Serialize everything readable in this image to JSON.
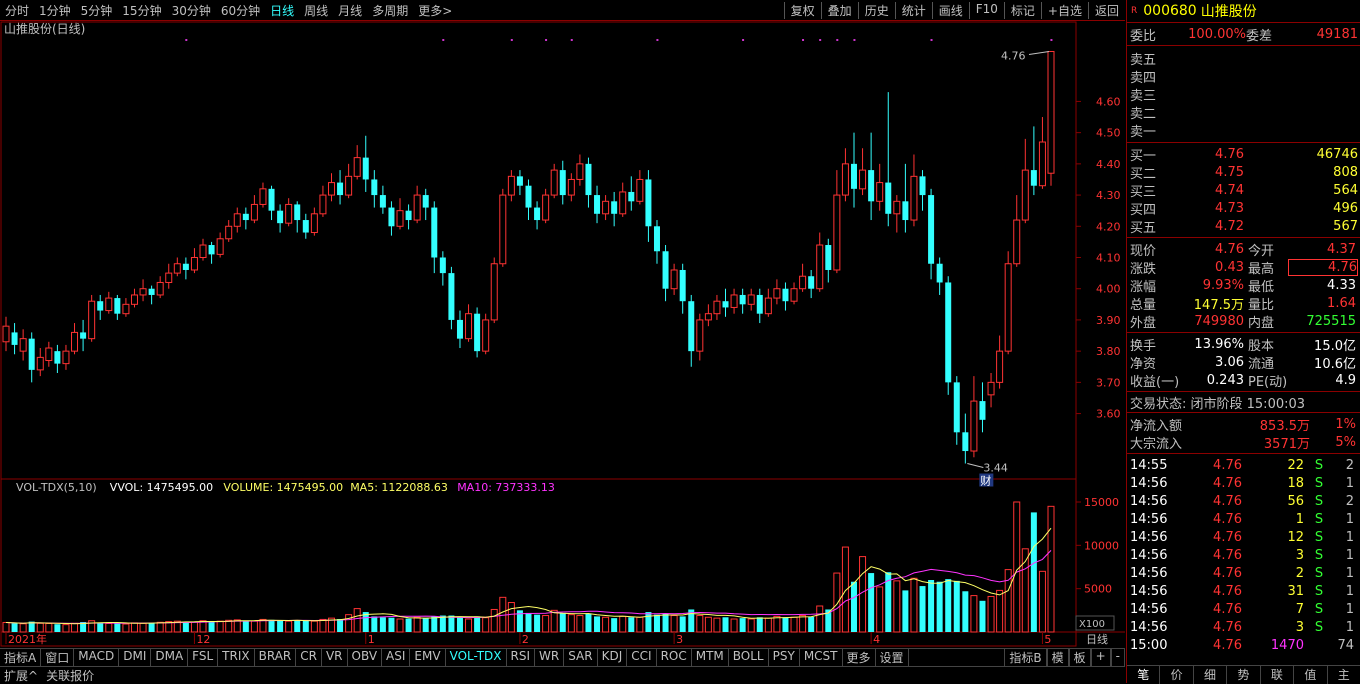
{
  "toolbar": {
    "periods": [
      {
        "label": "分时"
      },
      {
        "label": "1分钟"
      },
      {
        "label": "5分钟"
      },
      {
        "label": "15分钟"
      },
      {
        "label": "30分钟"
      },
      {
        "label": "60分钟"
      },
      {
        "label": "日线",
        "active": true
      },
      {
        "label": "周线"
      },
      {
        "label": "月线"
      },
      {
        "label": "多周期"
      },
      {
        "label": "更多>"
      }
    ],
    "tools": [
      "复权",
      "叠加",
      "历史",
      "统计",
      "画线",
      "F10",
      "标记",
      "+自选",
      "返回"
    ]
  },
  "chart": {
    "title": "山推股份(日线)",
    "price_labels": [
      "4.60",
      "4.50",
      "4.40",
      "4.30",
      "4.20",
      "4.10",
      "4.00",
      "3.90",
      "3.80",
      "3.70",
      "3.60"
    ],
    "max_marker": "4.76",
    "min_marker": "3.44",
    "fin_badge": "财",
    "vol_header": {
      "name": "VOL-TDX(5,10)",
      "vvol": "VVOL: 1475495.00",
      "volume": "VOLUME: 1475495.00",
      "ma5": "MA5: 1122088.63",
      "ma10": "MA10: 737333.13"
    },
    "vol_labels": [
      "15000",
      "10000",
      "5000"
    ],
    "vol_unit": "X100",
    "date_labels": [
      {
        "text": "2021年",
        "i": 0
      },
      {
        "text": "12",
        "i": 22
      },
      {
        "text": "1",
        "i": 42
      },
      {
        "text": "2",
        "i": 60
      },
      {
        "text": "3",
        "i": 78
      },
      {
        "text": "4",
        "i": 101
      },
      {
        "text": "5",
        "i": 121
      }
    ],
    "period_label": "日线"
  },
  "chart_data": {
    "type": "candlestick",
    "ylim": [
      3.4,
      4.8
    ],
    "vol_ylim": [
      0,
      16500
    ],
    "candles": [
      [
        3.83,
        3.88,
        3.8,
        3.91
      ],
      [
        3.86,
        3.82,
        3.79,
        3.89
      ],
      [
        3.8,
        3.84,
        3.77,
        3.87
      ],
      [
        3.84,
        3.74,
        3.7,
        3.86
      ],
      [
        3.74,
        3.78,
        3.72,
        3.81
      ],
      [
        3.77,
        3.81,
        3.75,
        3.83
      ],
      [
        3.8,
        3.76,
        3.73,
        3.82
      ],
      [
        3.76,
        3.8,
        3.74,
        3.82
      ],
      [
        3.8,
        3.86,
        3.79,
        3.89
      ],
      [
        3.86,
        3.84,
        3.8,
        3.9
      ],
      [
        3.84,
        3.96,
        3.83,
        3.98
      ],
      [
        3.96,
        3.93,
        3.9,
        3.98
      ],
      [
        3.93,
        3.97,
        3.92,
        3.99
      ],
      [
        3.97,
        3.92,
        3.9,
        3.98
      ],
      [
        3.92,
        3.95,
        3.91,
        3.97
      ],
      [
        3.95,
        3.98,
        3.94,
        4.0
      ],
      [
        3.98,
        4.0,
        3.96,
        4.03
      ],
      [
        4.0,
        3.98,
        3.95,
        4.01
      ],
      [
        3.98,
        4.02,
        3.97,
        4.04
      ],
      [
        4.02,
        4.05,
        4.0,
        4.08
      ],
      [
        4.05,
        4.08,
        4.04,
        4.1
      ],
      [
        4.08,
        4.06,
        4.03,
        4.1
      ],
      [
        4.06,
        4.1,
        4.05,
        4.13
      ],
      [
        4.1,
        4.14,
        4.09,
        4.16
      ],
      [
        4.14,
        4.11,
        4.08,
        4.15
      ],
      [
        4.11,
        4.16,
        4.1,
        4.18
      ],
      [
        4.16,
        4.2,
        4.15,
        4.22
      ],
      [
        4.2,
        4.24,
        4.18,
        4.26
      ],
      [
        4.24,
        4.22,
        4.19,
        4.26
      ],
      [
        4.22,
        4.27,
        4.21,
        4.3
      ],
      [
        4.27,
        4.32,
        4.26,
        4.34
      ],
      [
        4.32,
        4.25,
        4.22,
        4.33
      ],
      [
        4.25,
        4.21,
        4.18,
        4.27
      ],
      [
        4.21,
        4.27,
        4.2,
        4.29
      ],
      [
        4.27,
        4.22,
        4.18,
        4.28
      ],
      [
        4.22,
        4.18,
        4.16,
        4.24
      ],
      [
        4.18,
        4.24,
        4.17,
        4.26
      ],
      [
        4.24,
        4.3,
        4.23,
        4.33
      ],
      [
        4.3,
        4.34,
        4.28,
        4.37
      ],
      [
        4.34,
        4.3,
        4.27,
        4.38
      ],
      [
        4.3,
        4.36,
        4.29,
        4.4
      ],
      [
        4.36,
        4.42,
        4.35,
        4.46
      ],
      [
        4.42,
        4.35,
        4.31,
        4.49
      ],
      [
        4.35,
        4.3,
        4.26,
        4.38
      ],
      [
        4.3,
        4.26,
        4.24,
        4.33
      ],
      [
        4.26,
        4.2,
        4.17,
        4.28
      ],
      [
        4.2,
        4.25,
        4.19,
        4.29
      ],
      [
        4.25,
        4.22,
        4.19,
        4.27
      ],
      [
        4.22,
        4.3,
        4.21,
        4.33
      ],
      [
        4.3,
        4.26,
        4.22,
        4.32
      ],
      [
        4.26,
        4.1,
        4.05,
        4.28
      ],
      [
        4.1,
        4.05,
        4.01,
        4.12
      ],
      [
        4.05,
        3.9,
        3.87,
        4.07
      ],
      [
        3.9,
        3.84,
        3.81,
        3.93
      ],
      [
        3.84,
        3.92,
        3.83,
        3.95
      ],
      [
        3.92,
        3.8,
        3.78,
        3.94
      ],
      [
        3.8,
        3.9,
        3.79,
        3.92
      ],
      [
        3.9,
        4.08,
        3.89,
        4.1
      ],
      [
        4.08,
        4.3,
        4.07,
        4.32
      ],
      [
        4.3,
        4.36,
        4.28,
        4.38
      ],
      [
        4.36,
        4.33,
        4.3,
        4.38
      ],
      [
        4.33,
        4.26,
        4.22,
        4.35
      ],
      [
        4.26,
        4.22,
        4.19,
        4.28
      ],
      [
        4.22,
        4.3,
        4.21,
        4.32
      ],
      [
        4.3,
        4.38,
        4.29,
        4.4
      ],
      [
        4.38,
        4.3,
        4.27,
        4.41
      ],
      [
        4.3,
        4.35,
        4.28,
        4.37
      ],
      [
        4.35,
        4.4,
        4.33,
        4.43
      ],
      [
        4.4,
        4.3,
        4.26,
        4.42
      ],
      [
        4.3,
        4.24,
        4.21,
        4.33
      ],
      [
        4.24,
        4.28,
        4.22,
        4.3
      ],
      [
        4.28,
        4.24,
        4.2,
        4.31
      ],
      [
        4.24,
        4.31,
        4.23,
        4.34
      ],
      [
        4.31,
        4.28,
        4.25,
        4.36
      ],
      [
        4.28,
        4.35,
        4.27,
        4.38
      ],
      [
        4.35,
        4.2,
        4.15,
        4.38
      ],
      [
        4.2,
        4.12,
        4.08,
        4.22
      ],
      [
        4.12,
        4.0,
        3.96,
        4.14
      ],
      [
        4.0,
        4.06,
        3.98,
        4.08
      ],
      [
        4.06,
        3.96,
        3.92,
        4.08
      ],
      [
        3.96,
        3.8,
        3.75,
        3.98
      ],
      [
        3.8,
        3.9,
        3.77,
        3.92
      ],
      [
        3.9,
        3.92,
        3.88,
        3.95
      ],
      [
        3.92,
        3.96,
        3.9,
        3.98
      ],
      [
        3.96,
        3.94,
        3.91,
        4.0
      ],
      [
        3.94,
        3.98,
        3.92,
        4.0
      ],
      [
        3.98,
        3.95,
        3.92,
        4.0
      ],
      [
        3.95,
        3.98,
        3.93,
        4.0
      ],
      [
        3.98,
        3.92,
        3.89,
        4.0
      ],
      [
        3.92,
        3.97,
        3.91,
        4.0
      ],
      [
        3.97,
        4.0,
        3.95,
        4.03
      ],
      [
        4.0,
        3.96,
        3.93,
        4.02
      ],
      [
        3.96,
        4.0,
        3.95,
        4.02
      ],
      [
        4.0,
        4.04,
        3.99,
        4.08
      ],
      [
        4.04,
        4.0,
        3.97,
        4.06
      ],
      [
        4.0,
        4.14,
        3.99,
        4.18
      ],
      [
        4.14,
        4.06,
        4.02,
        4.16
      ],
      [
        4.06,
        4.3,
        4.05,
        4.38
      ],
      [
        4.3,
        4.4,
        4.28,
        4.45
      ],
      [
        4.4,
        4.32,
        4.26,
        4.5
      ],
      [
        4.32,
        4.38,
        4.3,
        4.45
      ],
      [
        4.38,
        4.28,
        4.22,
        4.5
      ],
      [
        4.28,
        4.34,
        4.25,
        4.4
      ],
      [
        4.34,
        4.24,
        4.2,
        4.63
      ],
      [
        4.24,
        4.28,
        4.18,
        4.3
      ],
      [
        4.28,
        4.22,
        4.18,
        4.4
      ],
      [
        4.22,
        4.36,
        4.2,
        4.43
      ],
      [
        4.36,
        4.3,
        4.25,
        4.38
      ],
      [
        4.3,
        4.08,
        4.03,
        4.32
      ],
      [
        4.08,
        4.02,
        3.98,
        4.1
      ],
      [
        4.02,
        3.7,
        3.66,
        4.04
      ],
      [
        3.7,
        3.54,
        3.5,
        3.72
      ],
      [
        3.54,
        3.48,
        3.44,
        3.6
      ],
      [
        3.48,
        3.64,
        3.46,
        3.72
      ],
      [
        3.64,
        3.58,
        3.54,
        3.7
      ],
      [
        3.66,
        3.7,
        3.62,
        3.73
      ],
      [
        3.7,
        3.8,
        3.68,
        3.85
      ],
      [
        3.8,
        4.08,
        3.79,
        4.12
      ],
      [
        4.08,
        4.22,
        4.07,
        4.3
      ],
      [
        4.22,
        4.38,
        4.21,
        4.48
      ],
      [
        4.38,
        4.33,
        4.3,
        4.52
      ],
      [
        4.33,
        4.47,
        4.32,
        4.55
      ],
      [
        4.37,
        4.76,
        4.33,
        4.76
      ]
    ],
    "volumes": [
      1100,
      1000,
      950,
      1200,
      1000,
      980,
      900,
      850,
      1000,
      1150,
      1300,
      1050,
      980,
      1000,
      920,
      1050,
      1000,
      1080,
      1120,
      1200,
      1250,
      1180,
      1150,
      1300,
      1200,
      1250,
      1350,
      1400,
      1300,
      1250,
      1450,
      1400,
      1300,
      1250,
      1350,
      1300,
      1250,
      1450,
      1600,
      1500,
      2000,
      2700,
      2300,
      1800,
      1700,
      1650,
      1500,
      1550,
      1700,
      1600,
      1800,
      1900,
      1900,
      1700,
      1500,
      1800,
      1650,
      2600,
      4000,
      3400,
      2500,
      2200,
      2000,
      1900,
      2500,
      2200,
      2000,
      1900,
      2100,
      1800,
      1700,
      1600,
      1800,
      1700,
      1700,
      2300,
      2000,
      2100,
      1900,
      1800,
      2600,
      1900,
      1700,
      1600,
      1700,
      1500,
      1600,
      1500,
      1700,
      1600,
      1800,
      1700,
      1700,
      1900,
      1750,
      3000,
      2600,
      6800,
      9800,
      5800,
      8700,
      6800,
      5200,
      6900,
      5900,
      4800,
      6200,
      5300,
      6000,
      5800,
      6100,
      5900,
      4700,
      4200,
      3600,
      4100,
      4800,
      7200,
      15000,
      9600,
      13800,
      7000,
      14500
    ],
    "ma5": [
      1100,
      1050,
      1017,
      1063,
      1050,
      1026,
      1006,
      986,
      946,
      980,
      1040,
      1070,
      1096,
      1096,
      1050,
      1000,
      1010,
      1026,
      1050,
      1090,
      1130,
      1166,
      1180,
      1216,
      1216,
      1216,
      1250,
      1300,
      1300,
      1310,
      1350,
      1360,
      1340,
      1330,
      1350,
      1310,
      1290,
      1330,
      1390,
      1420,
      1560,
      1850,
      2020,
      2060,
      2100,
      2030,
      1790,
      1640,
      1620,
      1600,
      1630,
      1700,
      1760,
      1780,
      1760,
      1760,
      1700,
      1840,
      2310,
      2700,
      2830,
      2940,
      2820,
      2600,
      2220,
      2160,
      2120,
      2100,
      2140,
      2000,
      1900,
      1820,
      1840,
      1760,
      1700,
      1820,
      1900,
      1960,
      1960,
      1960,
      2140,
      2060,
      2020,
      1920,
      1920,
      1860,
      1700,
      1580,
      1600,
      1580,
      1640,
      1660,
      1700,
      1740,
      1770,
      2010,
      2190,
      3210,
      4780,
      5640,
      6740,
      7540,
      7260,
      6680,
      6700,
      5920,
      6140,
      5820,
      5640,
      5620,
      5940,
      5820,
      5700,
      5340,
      4880,
      4500,
      4280,
      4780,
      7140,
      8140,
      9880,
      10720,
      11980
    ],
    "ma10": [
      1100,
      1050,
      1017,
      1063,
      1050,
      1038,
      1021,
      1000,
      995,
      1010,
      1030,
      1036,
      1038,
      1018,
      1010,
      1022,
      1024,
      1036,
      1048,
      1054,
      1084,
      1096,
      1113,
      1143,
      1171,
      1198,
      1228,
      1253,
      1262,
      1266,
      1291,
      1313,
      1328,
      1323,
      1333,
      1333,
      1323,
      1333,
      1363,
      1383,
      1433,
      1563,
      1663,
      1713,
      1748,
      1788,
      1813,
      1823,
      1823,
      1833,
      1813,
      1733,
      1693,
      1683,
      1663,
      1678,
      1693,
      1798,
      1928,
      2038,
      2108,
      2138,
      2148,
      2168,
      2268,
      2308,
      2343,
      2343,
      2403,
      2393,
      2313,
      2233,
      2213,
      2193,
      2113,
      2103,
      2113,
      2133,
      2113,
      2133,
      2223,
      2253,
      2213,
      2183,
      2183,
      2103,
      2063,
      2003,
      2023,
      2003,
      2023,
      2013,
      2013,
      2033,
      2038,
      2088,
      2178,
      2698,
      3568,
      3978,
      4588,
      5098,
      5448,
      5948,
      6198,
      6378,
      6818,
      7018,
      7218,
      7108,
      6998,
      6828,
      6568,
      6508,
      6253,
      5958,
      5778,
      5968,
      6908,
      7298,
      7948,
      8378,
      9418
    ]
  },
  "quote": {
    "market_badge": "R",
    "code": "000680",
    "name": "山推股份",
    "webi_label": "委比",
    "webi": "100.00%",
    "weicha_label": "委差",
    "weicha": "49181",
    "sell": [
      {
        "label": "卖五"
      },
      {
        "label": "卖四"
      },
      {
        "label": "卖三"
      },
      {
        "label": "卖二"
      },
      {
        "label": "卖一"
      }
    ],
    "buy": [
      {
        "label": "买一",
        "price": "4.76",
        "vol": "46746"
      },
      {
        "label": "买二",
        "price": "4.75",
        "vol": "808"
      },
      {
        "label": "买三",
        "price": "4.74",
        "vol": "564"
      },
      {
        "label": "买四",
        "price": "4.73",
        "vol": "496"
      },
      {
        "label": "买五",
        "price": "4.72",
        "vol": "567"
      }
    ],
    "stats": [
      {
        "l1": "现价",
        "v1": "4.76",
        "c1": "red",
        "l2": "今开",
        "v2": "4.37",
        "c2": "red"
      },
      {
        "l1": "涨跌",
        "v1": "0.43",
        "c1": "red",
        "l2": "最高",
        "v2": "4.76",
        "c2": "red",
        "box2": true
      },
      {
        "l1": "涨幅",
        "v1": "9.93%",
        "c1": "red",
        "l2": "最低",
        "v2": "4.33",
        "c2": "wht"
      },
      {
        "l1": "总量",
        "v1": "147.5万",
        "c1": "yel",
        "l2": "量比",
        "v2": "1.64",
        "c2": "red"
      },
      {
        "l1": "外盘",
        "v1": "749980",
        "c1": "red",
        "l2": "内盘",
        "v2": "725515",
        "c2": "grn"
      }
    ],
    "stats2": [
      {
        "l1": "换手",
        "v1": "13.96%",
        "l2": "股本",
        "v2": "15.0亿"
      },
      {
        "l1": "净资",
        "v1": "3.06",
        "l2": "流通",
        "v2": "10.6亿"
      },
      {
        "l1": "收益(一)",
        "v1": "0.243",
        "l2": "PE(动)",
        "v2": "4.9"
      }
    ],
    "trade_state": "交易状态: 闭市阶段 15:00:03",
    "netflow": [
      {
        "label": "净流入额",
        "value": "853.5万",
        "pct": "1%"
      },
      {
        "label": "大宗流入",
        "value": "3571万",
        "pct": "5%"
      }
    ],
    "ticks": [
      {
        "t": "14:55",
        "p": "4.76",
        "v": "22",
        "s": "S",
        "n": "2"
      },
      {
        "t": "14:56",
        "p": "4.76",
        "v": "18",
        "s": "S",
        "n": "1"
      },
      {
        "t": "14:56",
        "p": "4.76",
        "v": "56",
        "s": "S",
        "n": "2"
      },
      {
        "t": "14:56",
        "p": "4.76",
        "v": "1",
        "s": "S",
        "n": "1"
      },
      {
        "t": "14:56",
        "p": "4.76",
        "v": "12",
        "s": "S",
        "n": "1"
      },
      {
        "t": "14:56",
        "p": "4.76",
        "v": "3",
        "s": "S",
        "n": "1"
      },
      {
        "t": "14:56",
        "p": "4.76",
        "v": "2",
        "s": "S",
        "n": "1"
      },
      {
        "t": "14:56",
        "p": "4.76",
        "v": "31",
        "s": "S",
        "n": "1"
      },
      {
        "t": "14:56",
        "p": "4.76",
        "v": "7",
        "s": "S",
        "n": "1"
      },
      {
        "t": "14:56",
        "p": "4.76",
        "v": "3",
        "s": "S",
        "n": "1"
      },
      {
        "t": "15:00",
        "p": "4.76",
        "v": "1470",
        "s": "",
        "n": "74"
      }
    ],
    "tabs": [
      "笔",
      "价",
      "细",
      "势",
      "联",
      "值",
      "主"
    ]
  },
  "indicators": [
    "指标A",
    "窗口",
    "MACD",
    "DMI",
    "DMA",
    "FSL",
    "TRIX",
    "BRAR",
    "CR",
    "VR",
    "OBV",
    "ASI",
    "EMV",
    "VOL-TDX",
    "RSI",
    "WR",
    "SAR",
    "KDJ",
    "CCI",
    "ROC",
    "MTM",
    "BOLL",
    "PSY",
    "MCST",
    "更多",
    "设置"
  ],
  "indicator_right": [
    "指标B",
    "模",
    "板",
    "+",
    "-"
  ],
  "status": [
    "扩展^",
    "关联报价"
  ],
  "colors": {
    "up": "#ff3333",
    "down": "#33ffff",
    "grid": "#8b0000",
    "ma5": "#ffff66",
    "ma10": "#ff33ff"
  }
}
